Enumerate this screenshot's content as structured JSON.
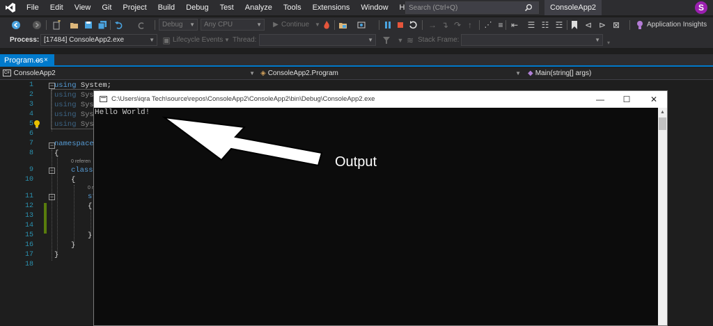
{
  "menu": {
    "items": [
      "File",
      "Edit",
      "View",
      "Git",
      "Project",
      "Build",
      "Debug",
      "Test",
      "Analyze",
      "Tools",
      "Extensions",
      "Window",
      "Help"
    ],
    "search_placeholder": "Search (Ctrl+Q)",
    "solution_name": "ConsoleApp2",
    "user_initial": "S"
  },
  "toolbar": {
    "configuration": "Debug",
    "platform": "Any CPU",
    "continue_label": "Continue",
    "application_insights_label": "Application Insights"
  },
  "debug_toolbar": {
    "process_label": "Process:",
    "process_value": "[17484] ConsoleApp2.exe",
    "lifecycle_label": "Lifecycle Events",
    "thread_label": "Thread:",
    "stack_frame_label": "Stack Frame:"
  },
  "tabs": [
    {
      "label": "Program.cs",
      "pin": "⊸",
      "close": "×"
    }
  ],
  "navbar": {
    "project": "ConsoleApp2",
    "type": "ConsoleApp2.Program",
    "member": "Main(string[] args)",
    "project_icon": "C#"
  },
  "editor": {
    "line_numbers": [
      "1",
      "2",
      "3",
      "4",
      "5",
      "6",
      "7",
      "8",
      "9",
      "10",
      "11",
      "12",
      "13",
      "14",
      "15",
      "16",
      "17",
      "18"
    ],
    "lines": {
      "l1_kw": "using",
      "l1_rest": " System;",
      "l2_kw": "using",
      "l2_rest": " Syst",
      "l3_kw": "using",
      "l3_rest": " Syst",
      "l4_kw": "using",
      "l4_rest": " Syst",
      "l5_kw": "using",
      "l5_rest": " Syst",
      "l7_kw": "namespace",
      "l8": "{",
      "ref1": "0 referen",
      "l9_kw": "class",
      "l10": "{",
      "ref2": "0 r",
      "l11_kw": "st",
      "l12": "{",
      "l14": "}",
      "l15": "}",
      "l16": "}"
    }
  },
  "console": {
    "title": "C:\\Users\\iqra Tech\\source\\repos\\ConsoleApp2\\ConsoleApp2\\bin\\Debug\\ConsoleApp2.exe",
    "output": "Hello World!",
    "minimize": "—",
    "maximize": "☐",
    "close": "✕"
  },
  "annotation": {
    "label": "Output"
  },
  "colors": {
    "accent": "#007acc",
    "chrome": "#2d2d30",
    "editor_bg": "#1e1e1e",
    "keyword": "#569cd6",
    "line_number": "#2b91af",
    "console_bg": "#0c0c0c",
    "avatar": "#9b1fb0"
  },
  "icons": [
    "visual-studio-logo-icon",
    "search-icon",
    "back-icon",
    "forward-icon",
    "new-project-icon",
    "open-icon",
    "save-icon",
    "save-all-icon",
    "undo-icon",
    "redo-icon",
    "continue-icon",
    "hot-reload-icon",
    "pause-icon",
    "stop-icon",
    "restart-icon",
    "step-into-icon",
    "step-over-icon",
    "step-out-icon",
    "lightbulb-icon",
    "filter-icon",
    "application-insights-icon"
  ]
}
